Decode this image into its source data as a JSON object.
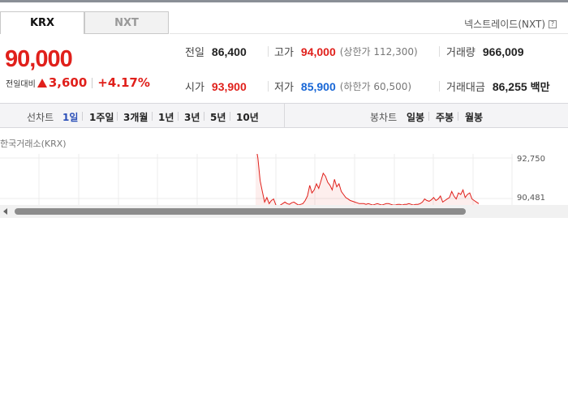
{
  "market_tabs": [
    {
      "label": "KRX",
      "active": true
    },
    {
      "label": "NXT",
      "active": false
    }
  ],
  "nxt_link": {
    "label": "넥스트레이드(NXT)",
    "help": "?"
  },
  "price": {
    "current": "90,000",
    "change_label": "전일대비",
    "change_value": "3,600",
    "change_pct": "+4.17%"
  },
  "stats": {
    "prev_close": {
      "label": "전일",
      "value": "86,400"
    },
    "high": {
      "label": "고가",
      "value": "94,000",
      "sub": "(상한가 112,300)"
    },
    "volume": {
      "label": "거래량",
      "value": "966,009"
    },
    "open": {
      "label": "시가",
      "value": "93,900"
    },
    "low": {
      "label": "저가",
      "value": "85,900",
      "sub": "(하한가 60,500)"
    },
    "trade_value": {
      "label": "거래대금",
      "value": "86,255",
      "unit": "백만"
    }
  },
  "period_bar": {
    "line_label": "선차트",
    "line_periods": [
      "1일",
      "1주일",
      "3개월",
      "1년",
      "3년",
      "5년",
      "10년"
    ],
    "active_period": "1일",
    "candle_label": "봉차트",
    "candle_periods": [
      "일봉",
      "주봉",
      "월봉"
    ]
  },
  "chart_data": {
    "type": "line",
    "title": "한국거래소(KRX)",
    "y_ticks": [
      "92,750",
      "90,481"
    ],
    "ylim": [
      89800,
      93000
    ],
    "x": [
      0,
      1,
      2,
      3,
      4,
      5,
      6,
      7,
      8,
      9,
      10,
      11,
      12,
      13,
      14,
      15,
      16,
      17,
      18,
      19,
      20,
      21,
      22,
      23,
      24,
      25,
      26,
      27,
      28,
      29,
      30,
      31,
      32,
      33,
      34,
      35,
      36,
      37,
      38,
      39,
      40,
      41,
      42,
      43,
      44,
      45,
      46,
      47,
      48,
      49,
      50,
      51,
      52,
      53,
      54,
      55,
      56,
      57,
      58,
      59,
      60,
      61,
      62,
      63,
      64,
      65,
      66,
      67,
      68,
      69,
      70,
      71,
      72,
      73,
      74,
      75,
      76,
      77,
      78,
      79,
      80,
      81,
      82,
      83,
      84,
      85,
      86,
      87,
      88,
      89,
      90,
      91,
      92,
      93,
      94,
      95,
      96,
      97,
      98,
      99
    ],
    "values": [
      93900,
      93000,
      91500,
      90800,
      90100,
      90400,
      90000,
      90200,
      90300,
      89900,
      89800,
      89900,
      90000,
      90100,
      90000,
      89950,
      90050,
      90100,
      90000,
      89900,
      89950,
      90000,
      90200,
      90500,
      91200,
      90700,
      90900,
      91300,
      91000,
      91500,
      92000,
      91800,
      91400,
      91200,
      90900,
      91600,
      91100,
      91300,
      90800,
      90600,
      90400,
      90300,
      90200,
      90150,
      90100,
      90050,
      90000,
      90000,
      90000,
      89950,
      90000,
      89950,
      89900,
      89950,
      90000,
      89950,
      89900,
      89950,
      90000,
      90000,
      89950,
      89900,
      89900,
      89950,
      89950,
      89900,
      89950,
      89950,
      90000,
      89950,
      89900,
      89950,
      89950,
      90000,
      90100,
      90300,
      90200,
      90150,
      90250,
      90400,
      90200,
      90300,
      90500,
      90100,
      90200,
      90300,
      90400,
      90800,
      90500,
      90300,
      90700,
      90600,
      90900,
      90400,
      90600,
      90700,
      90300,
      90200,
      90100,
      90000
    ],
    "series_color": "#e0201b"
  }
}
